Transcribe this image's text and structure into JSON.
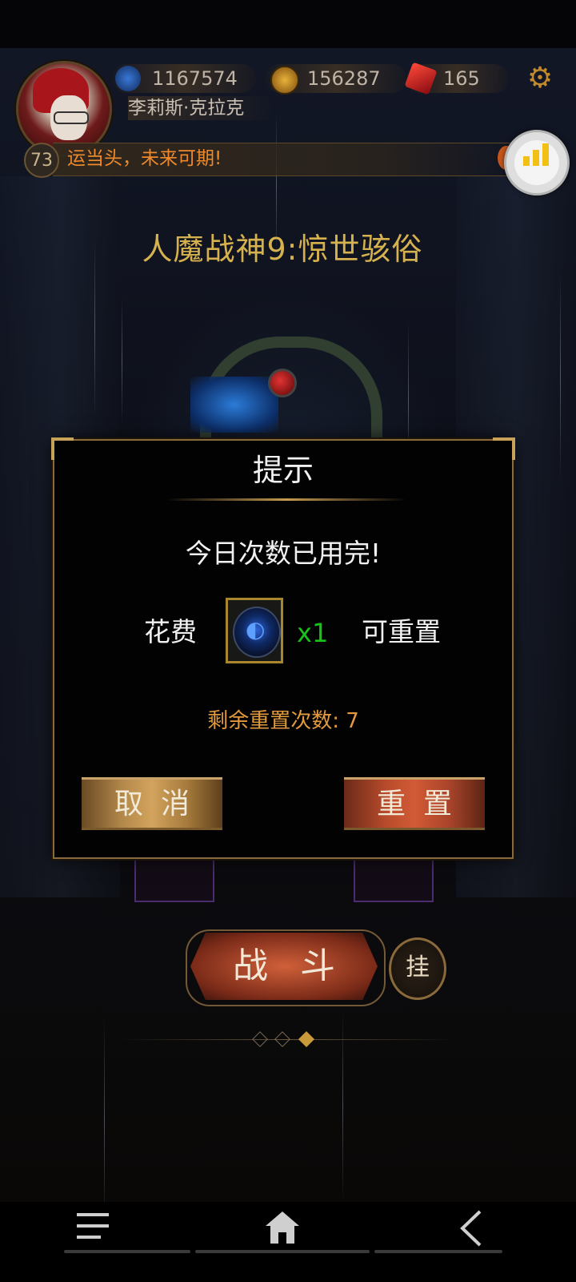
{
  "hud": {
    "crystal_count": "1167574",
    "gold_count": "156287",
    "gem_count": "165",
    "player_name": "李莉斯·克拉克",
    "level": "73",
    "motto": "运当头，未来可期!"
  },
  "stage": {
    "title": "人魔战神9:惊世骇俗"
  },
  "dialog": {
    "title": "提示",
    "message": "今日次数已用完!",
    "cost_prefix": "花费",
    "cost_quantity": "x1",
    "cost_suffix": "可重置",
    "remaining_label": "剩余重置次数: 7",
    "cancel_label": "取消",
    "reset_label": "重置"
  },
  "actions": {
    "battle_label": "战斗",
    "auto_label": "挂"
  },
  "icons": {
    "crystal": "blue-crystal-icon",
    "gold": "gold-coin-icon",
    "gem": "red-gem-icon",
    "settings": "gear-icon",
    "signal": "signal-bars-icon",
    "nav_menu": "menu-icon",
    "nav_home": "home-icon",
    "nav_back": "back-icon"
  },
  "colors": {
    "motto": "#ef8a2c",
    "stage_title": "#d6b24e",
    "cost_quantity": "#19c218",
    "remaining": "#e29a3c",
    "dialog_border": "#8a6a3a"
  }
}
